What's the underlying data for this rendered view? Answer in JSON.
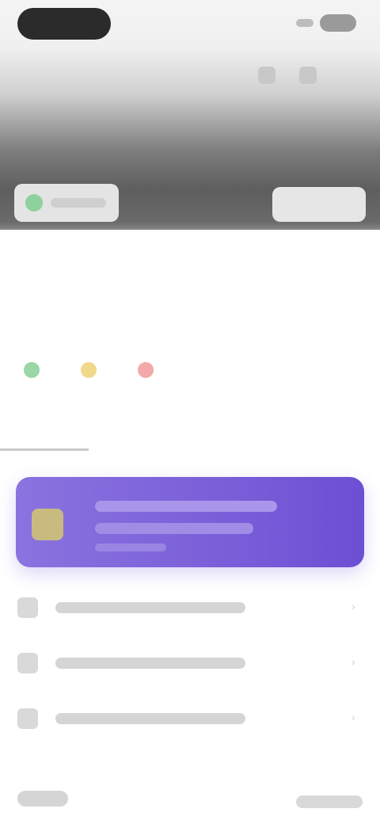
{
  "hero": {
    "title": "",
    "chip_left_label": "",
    "chip_right_label": ""
  },
  "meta": {
    "line": ""
  },
  "article": {
    "headline": ""
  },
  "reactions": [
    {
      "label": "",
      "color": "#9ad6a6"
    },
    {
      "label": "",
      "color": "#f0d98a"
    },
    {
      "label": "",
      "color": "#f3a9a9"
    }
  ],
  "tabs": [
    {
      "label": ""
    },
    {
      "label": ""
    },
    {
      "label": ""
    },
    {
      "label": ""
    },
    {
      "label": ""
    }
  ],
  "promo": {
    "accent_color": "#7a5ed9",
    "icon": "gift-icon"
  },
  "list": [
    {
      "icon": "document-icon",
      "label": ""
    },
    {
      "icon": "document-icon",
      "label": ""
    },
    {
      "icon": "document-icon",
      "label": ""
    }
  ],
  "footer": {
    "left_label": "",
    "right_label": ""
  }
}
